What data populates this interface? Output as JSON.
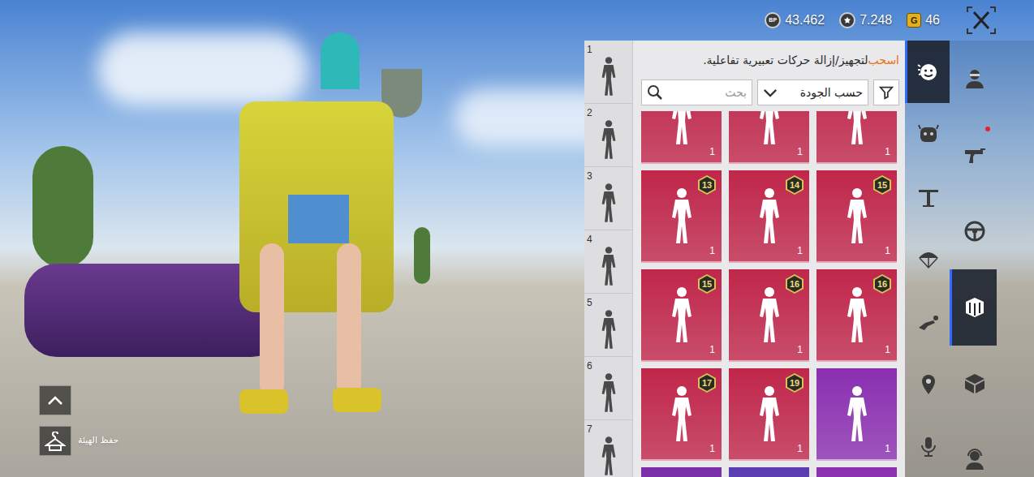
{
  "currencies": [
    {
      "kind": "bp",
      "icon_text": "BP",
      "amount": "43.462"
    },
    {
      "kind": "coin",
      "amount": "7.248"
    },
    {
      "kind": "gold",
      "icon_text": "G",
      "amount": "46"
    }
  ],
  "hint": {
    "highlight": "اسحب",
    "rest": " لتجهيز/إزالة حركات تعبيرية تفاعلية."
  },
  "search": {
    "placeholder": "بحث"
  },
  "sort": {
    "label": "حسب الجودة"
  },
  "slots": [
    {
      "number": "1"
    },
    {
      "number": "2"
    },
    {
      "number": "3"
    },
    {
      "number": "4"
    },
    {
      "number": "5"
    },
    {
      "number": "6"
    },
    {
      "number": "7"
    }
  ],
  "cards": [
    {
      "count": "1",
      "color": "#c0264a"
    },
    {
      "count": "1",
      "color": "#c0264a"
    },
    {
      "count": "1",
      "color": "#c0264a"
    },
    {
      "badge": "13",
      "count": "1",
      "color": "#c0264a"
    },
    {
      "badge": "14",
      "count": "1",
      "color": "#c0264a"
    },
    {
      "badge": "15",
      "count": "1",
      "color": "#c0264a"
    },
    {
      "badge": "15",
      "count": "1",
      "color": "#c0264a"
    },
    {
      "badge": "16",
      "count": "1",
      "color": "#c0264a"
    },
    {
      "badge": "16",
      "count": "1",
      "color": "#c0264a"
    },
    {
      "badge": "17",
      "count": "1",
      "color": "#c0264a"
    },
    {
      "badge": "19",
      "count": "1",
      "color": "#c0264a"
    },
    {
      "count": "1",
      "color": "#8a2fb0"
    },
    {
      "color": "#7a2ea8"
    },
    {
      "color": "#5a3cb0"
    },
    {
      "color": "#8a2fb0"
    }
  ],
  "sub_tabs": [
    {
      "selected": true
    },
    {
      "selected": false
    },
    {
      "selected": false
    },
    {
      "selected": false
    },
    {
      "selected": false
    },
    {
      "selected": false
    },
    {
      "selected": false
    }
  ],
  "categories": [
    {
      "selected": false,
      "dot": false
    },
    {
      "selected": false,
      "dot": true
    },
    {
      "selected": false,
      "dot": false
    },
    {
      "selected": true,
      "dot": false
    },
    {
      "selected": false,
      "dot": false
    },
    {
      "selected": false,
      "dot": false
    }
  ],
  "save_outfit": {
    "label": "حفظ الهيئة"
  }
}
